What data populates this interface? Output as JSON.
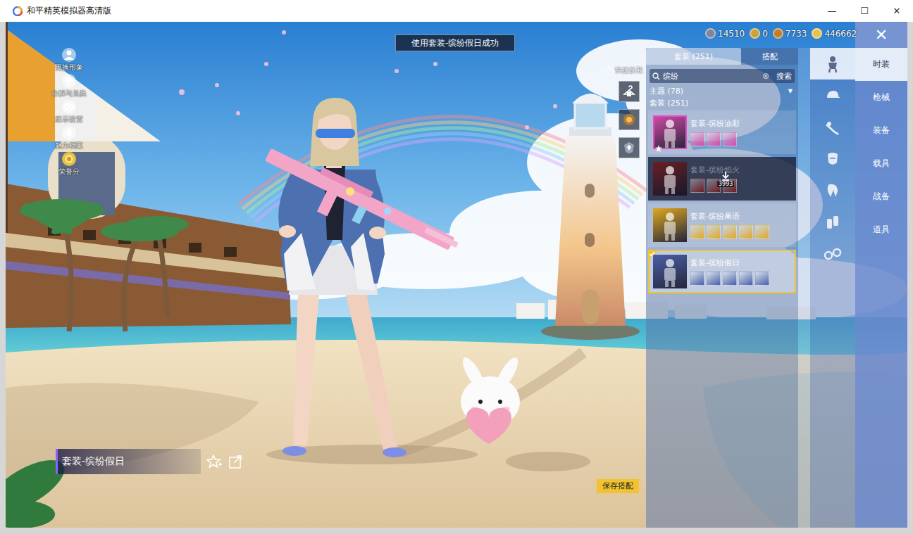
{
  "window": {
    "title": "和平精英模拟器高清版",
    "controls": [
      "—",
      "☐",
      "✕"
    ]
  },
  "toast": "使用套装-缤纷假日成功",
  "currencies": [
    {
      "amount": "14510",
      "color": "#7d8799"
    },
    {
      "amount": "0",
      "color": "#c9a23a"
    },
    {
      "amount": "7733",
      "color": "#c47d2a"
    },
    {
      "amount": "446662",
      "color": "#e6c34a"
    }
  ],
  "close": "✕",
  "left_menu": [
    {
      "label": "更换形象"
    },
    {
      "label": "分解与兑换"
    },
    {
      "label": "展示设置"
    },
    {
      "label": "魅力档案"
    },
    {
      "label": "荣誉分"
    }
  ],
  "quick_change": {
    "label": "快捷换装",
    "help": "?"
  },
  "outfit_name": "套装-缤纷假日",
  "save_button": "保存搭配",
  "list_panel": {
    "tabs": [
      {
        "label": "套装 (251)",
        "selected": true
      },
      {
        "label": "搭配",
        "selected": false
      }
    ],
    "search": {
      "value": "缤纷",
      "clear": "⊗",
      "button": "搜索"
    },
    "filter": {
      "label": "主题 (78)",
      "arrow": "▼"
    },
    "section": "套装 (251)",
    "items": [
      {
        "title": "套装-缤纷油彩",
        "selected": false,
        "downloading": false,
        "pieces": 3,
        "color": "#d64aa8"
      },
      {
        "title": "套装-缤纷焰火",
        "selected": false,
        "downloading": true,
        "progress": "3993",
        "pieces": 3,
        "color": "#6a1f24"
      },
      {
        "title": "套装-缤纷果语",
        "selected": false,
        "downloading": false,
        "pieces": 5,
        "color": "#e0a820"
      },
      {
        "title": "套装-缤纷假日",
        "selected": true,
        "downloading": false,
        "pieces": 5,
        "color": "#4a5fa8"
      }
    ]
  },
  "icon_tabs": [
    {
      "selected": true
    },
    {
      "selected": false
    },
    {
      "selected": false
    },
    {
      "selected": false
    },
    {
      "selected": false
    },
    {
      "selected": false
    },
    {
      "selected": false
    }
  ],
  "categories": [
    {
      "label": "时装",
      "selected": true
    },
    {
      "label": "枪械",
      "selected": false
    },
    {
      "label": "装备",
      "selected": false
    },
    {
      "label": "载具",
      "selected": false
    },
    {
      "label": "战备",
      "selected": false
    },
    {
      "label": "道具",
      "selected": false
    }
  ]
}
